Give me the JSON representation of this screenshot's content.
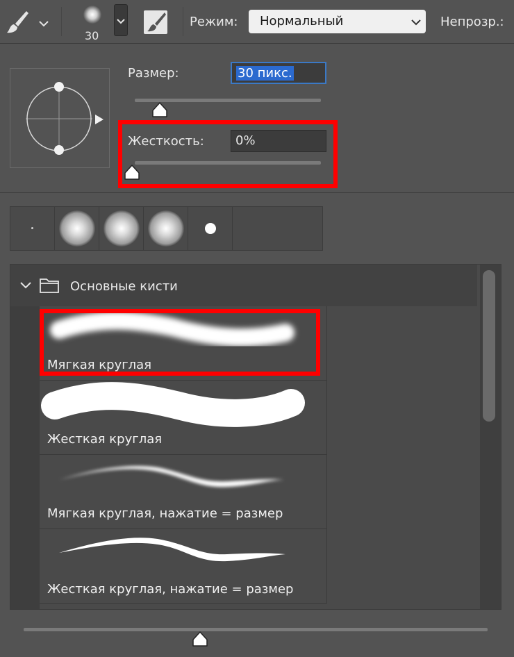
{
  "options_bar": {
    "brush_size": "30",
    "mode_label": "Режим:",
    "mode_value": "Нормальный",
    "opacity_label": "Непрозр.:"
  },
  "brush_settings": {
    "size_label": "Размер:",
    "size_value": "30 пикс.",
    "hardness_label": "Жесткость:",
    "hardness_value": "0%"
  },
  "brush_list": {
    "group_name": "Основные кисти",
    "items": [
      {
        "label": "Мягкая круглая"
      },
      {
        "label": "Жесткая круглая"
      },
      {
        "label": "Мягкая круглая, нажатие = размер"
      },
      {
        "label": "Жесткая круглая, нажатие = размер"
      }
    ]
  },
  "colors": {
    "panel_bg": "#535353",
    "highlight": "#ff0000",
    "selection": "#2b6acf"
  },
  "icons": [
    "brush-icon",
    "chevron-down-icon",
    "brush-tip-preview-icon",
    "brush-panel-icon",
    "folder-icon",
    "chevron-down-icon",
    "play-arrow-icon"
  ]
}
